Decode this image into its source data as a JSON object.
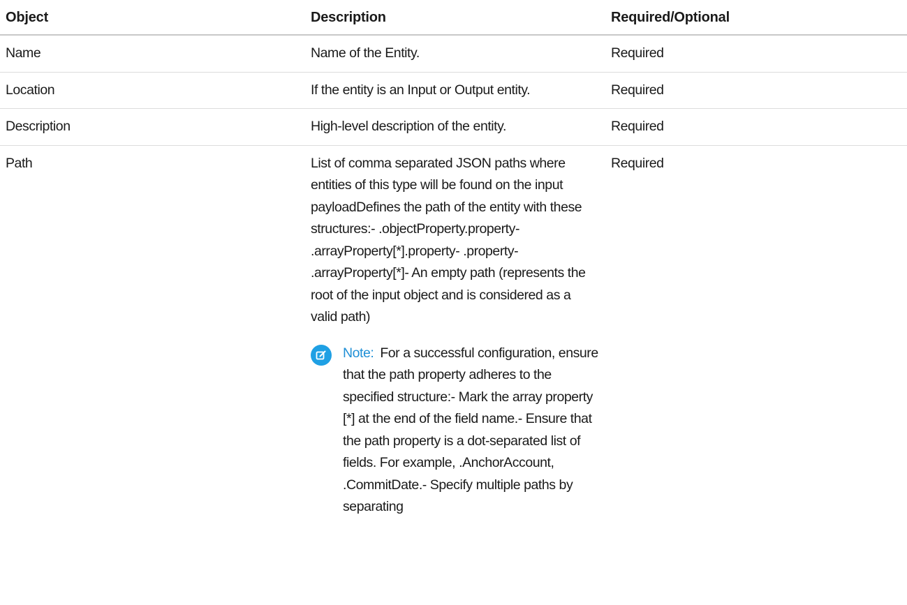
{
  "table": {
    "headers": {
      "object": "Object",
      "description": "Description",
      "required": "Required/Optional"
    },
    "rows": [
      {
        "object": "Name",
        "description": "Name of the Entity.",
        "required": "Required"
      },
      {
        "object": "Location",
        "description": "If the entity is an Input or Output entity.",
        "required": "Required"
      },
      {
        "object": "Description",
        "description": "High-level description of the entity.",
        "required": "Required"
      },
      {
        "object": "Path",
        "description": "List of comma separated JSON paths where entities of this type will be found on the input payloadDefines the path of the entity with these structures:- .objectProperty.property- .arrayProperty[*].property- .property- .arrayProperty[*]- An empty path (represents the root of the input object and is considered as a valid path)",
        "required": "Required",
        "note": {
          "icon": "edit-note-icon",
          "label": "Note:",
          "text": "For a successful configuration, ensure that the path property adheres to the specified structure:- Mark the array property [*] at the end of the field name.- Ensure that the path property is a dot-separated list of fields. For example, .AnchorAccount, .CommitDate.- Specify multiple paths by separating"
        }
      }
    ]
  },
  "colors": {
    "note_accent": "#1fa0e4",
    "header_border": "#c8c8c8",
    "row_border": "#dcdcdc"
  }
}
